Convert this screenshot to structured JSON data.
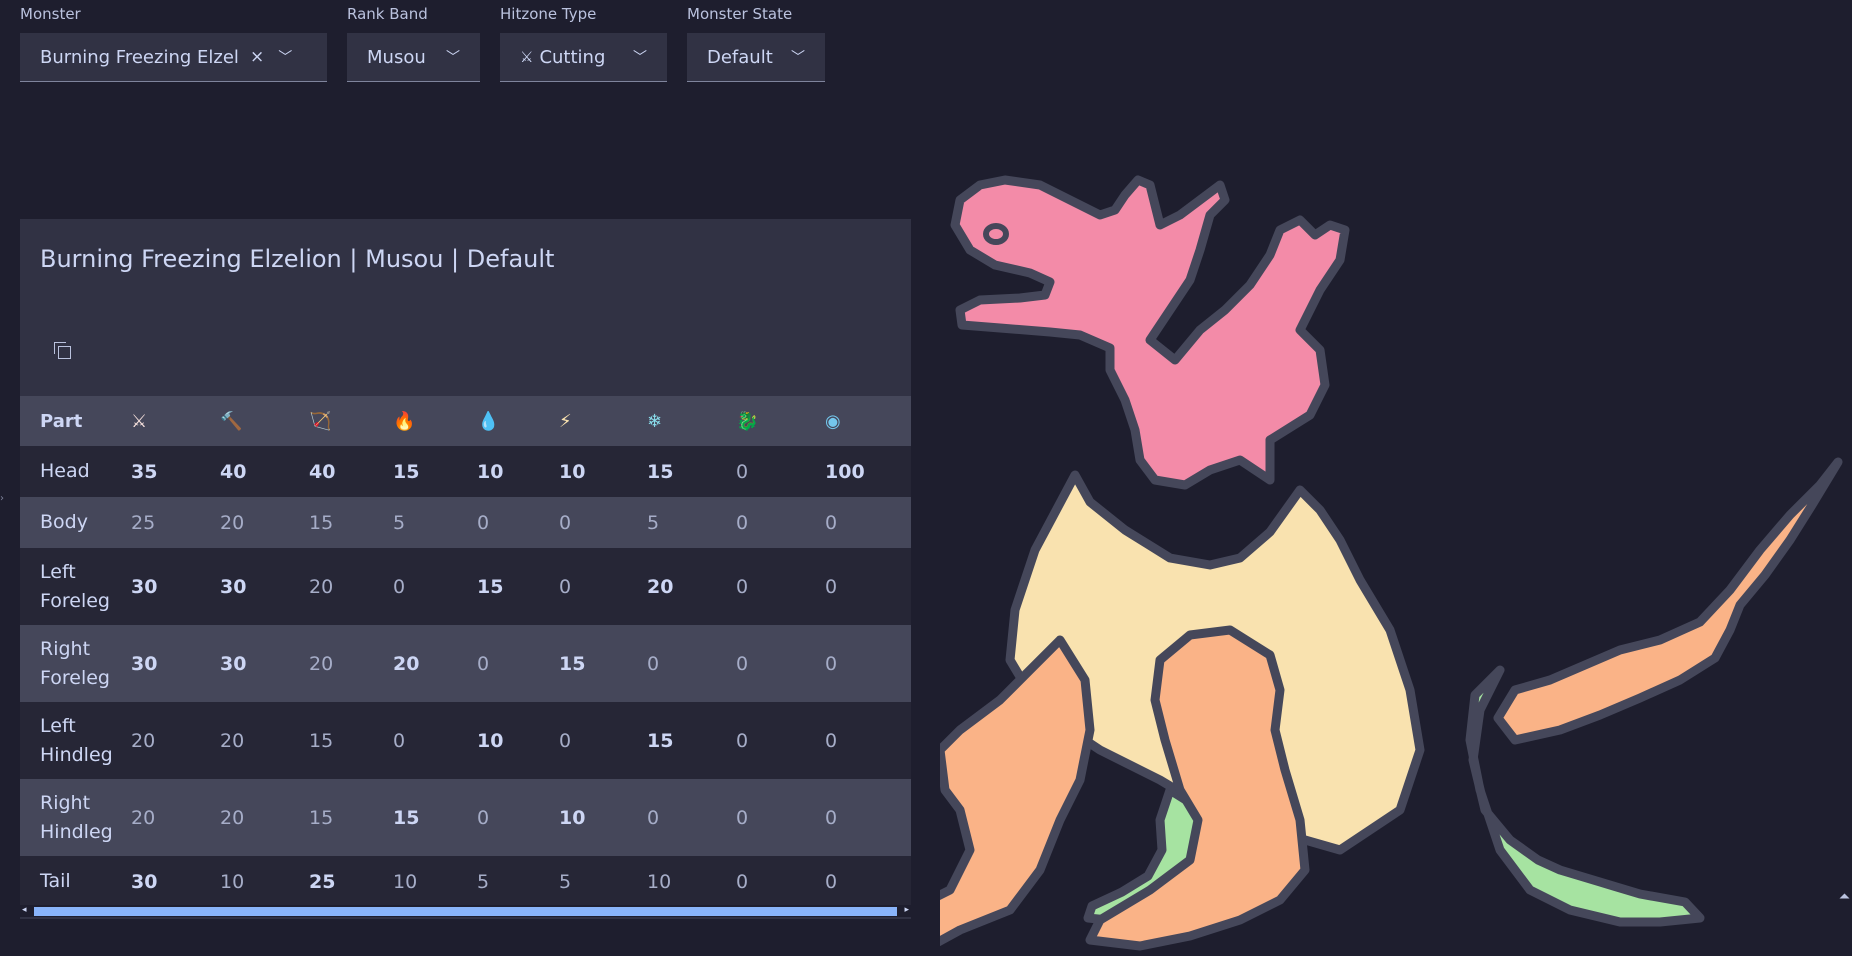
{
  "filters": {
    "monster": {
      "label": "Monster",
      "value": "Burning Freezing Elzelion",
      "clear": "×"
    },
    "rank": {
      "label": "Rank Band",
      "value": "Musou"
    },
    "hitzone": {
      "label": "Hitzone Type",
      "value": "Cutting",
      "icon": "⚔"
    },
    "state": {
      "label": "Monster State",
      "value": "Default"
    }
  },
  "panel": {
    "title": "Burning Freezing Elzelion | Musou | Default"
  },
  "table": {
    "part_header": "Part",
    "columns": [
      {
        "icon": "sword-icon",
        "glyph": "⚔",
        "color": "#f5e0dc"
      },
      {
        "icon": "hammer-icon",
        "glyph": "🔨",
        "color": "#fab387"
      },
      {
        "icon": "bow-icon",
        "glyph": "🏹",
        "color": "#fab387"
      },
      {
        "icon": "fire-icon",
        "glyph": "🔥",
        "color": "#f38ba8"
      },
      {
        "icon": "water-icon",
        "glyph": "💧",
        "color": "#89dceb"
      },
      {
        "icon": "thunder-icon",
        "glyph": "⚡",
        "color": "#f9e2af"
      },
      {
        "icon": "ice-icon",
        "glyph": "❄",
        "color": "#89dceb"
      },
      {
        "icon": "dragon-icon",
        "glyph": "🐉",
        "color": "#a6e3a1"
      },
      {
        "icon": "stun-icon",
        "glyph": "◉",
        "color": "#74c7ec"
      }
    ],
    "rows": [
      {
        "part": "Head",
        "values": [
          "35",
          "40",
          "40",
          "15",
          "10",
          "10",
          "15",
          "0",
          "100"
        ],
        "bold": [
          1,
          1,
          1,
          1,
          1,
          1,
          1,
          0,
          1
        ]
      },
      {
        "part": "Body",
        "values": [
          "25",
          "20",
          "15",
          "5",
          "0",
          "0",
          "5",
          "0",
          "0"
        ],
        "bold": [
          0,
          0,
          0,
          0,
          0,
          0,
          0,
          0,
          0
        ]
      },
      {
        "part": "Left Foreleg",
        "values": [
          "30",
          "30",
          "20",
          "0",
          "15",
          "0",
          "20",
          "0",
          "0"
        ],
        "bold": [
          1,
          1,
          0,
          0,
          1,
          0,
          1,
          0,
          0
        ]
      },
      {
        "part": "Right Foreleg",
        "values": [
          "30",
          "30",
          "20",
          "20",
          "0",
          "15",
          "0",
          "0",
          "0"
        ],
        "bold": [
          1,
          1,
          0,
          1,
          0,
          1,
          0,
          0,
          0
        ]
      },
      {
        "part": "Left Hindleg",
        "values": [
          "20",
          "20",
          "15",
          "0",
          "10",
          "0",
          "15",
          "0",
          "0"
        ],
        "bold": [
          0,
          0,
          0,
          0,
          1,
          0,
          1,
          0,
          0
        ]
      },
      {
        "part": "Right Hindleg",
        "values": [
          "20",
          "20",
          "15",
          "15",
          "0",
          "10",
          "0",
          "0",
          "0"
        ],
        "bold": [
          0,
          0,
          0,
          1,
          0,
          1,
          0,
          0,
          0
        ]
      },
      {
        "part": "Tail",
        "values": [
          "30",
          "10",
          "25",
          "10",
          "5",
          "5",
          "10",
          "0",
          "0"
        ],
        "bold": [
          1,
          0,
          1,
          0,
          0,
          0,
          0,
          0,
          0
        ]
      }
    ]
  },
  "colors": {
    "head": "#f38ba8",
    "body": "#f9e2af",
    "forelegs": "#fab387",
    "hindlegs": "#a6e3a1",
    "tail": "#fab387",
    "outline": "#45475a"
  }
}
